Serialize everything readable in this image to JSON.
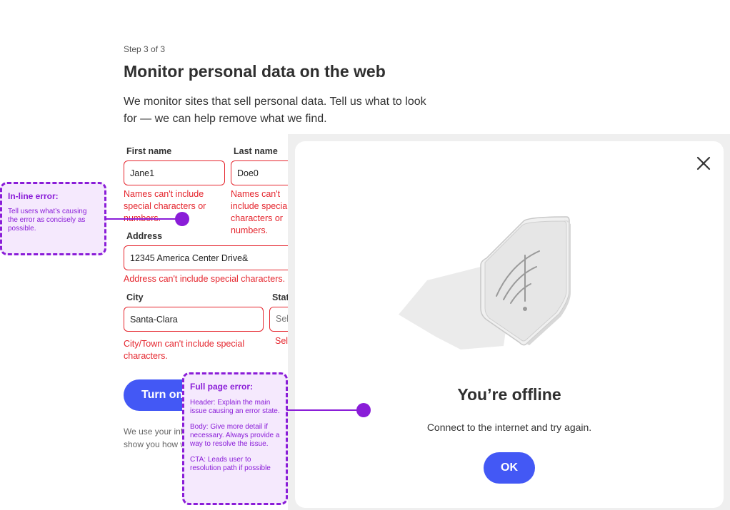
{
  "page": {
    "step": "Step 3 of 3",
    "title": "Monitor personal data on the web",
    "description": "We monitor sites that sell personal data. Tell us what to look for — we can help remove what we find."
  },
  "form": {
    "first_name": {
      "label": "First name",
      "value": "Jane1",
      "error": "Names can't include special characters or numbers."
    },
    "last_name": {
      "label": "Last name",
      "value": "Doe0",
      "error": "Names can't include special characters or numbers."
    },
    "address": {
      "label": "Address",
      "value": "12345 America Center Drive&",
      "error": "Address can't include special characters."
    },
    "city": {
      "label": "City",
      "value": "Santa-Clara",
      "error": "City/Town can't include special characters."
    },
    "state": {
      "label": "State",
      "value": "Select",
      "error": "Select"
    },
    "submit_label": "Turn on",
    "legal": "We use your info to look for your data and show you how we protect it."
  },
  "modal": {
    "title": "You’re offline",
    "body": "Connect to the internet and try again.",
    "ok_label": "OK",
    "illustration_icon": "wifi-off-icon",
    "close_icon": "close-icon"
  },
  "annotations": {
    "inline": {
      "title": "In-line error:",
      "text": "Tell users what’s causing the error as concisely as possible."
    },
    "full_page": {
      "title": "Full page error:",
      "header": "Header: Explain the main issue causing an error state.",
      "body": "Body: Give more detail if necessary. Always provide a way to resolve the issue.",
      "cta": "CTA: Leads user to resolution path if possible"
    }
  },
  "colors": {
    "accent": "#4358f5",
    "error": "#e5262e",
    "annotation": "#8a1dd8",
    "annotation_bg": "#f5e9fd"
  }
}
